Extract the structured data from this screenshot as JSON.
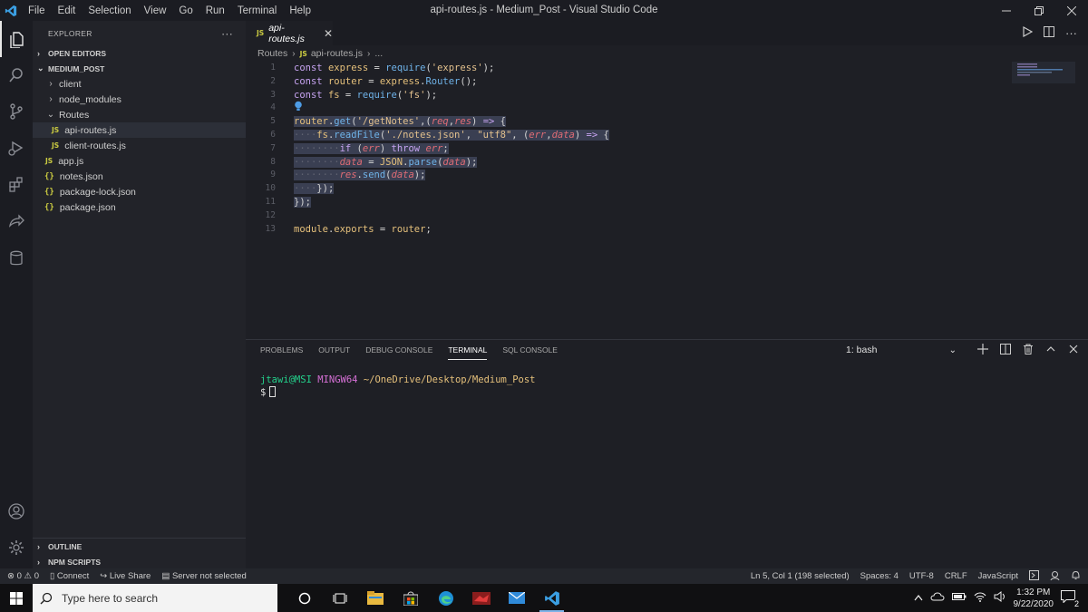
{
  "window": {
    "title": "api-routes.js - Medium_Post - Visual Studio Code",
    "menu": [
      "File",
      "Edit",
      "Selection",
      "View",
      "Go",
      "Run",
      "Terminal",
      "Help"
    ]
  },
  "sidebar": {
    "header": "EXPLORER",
    "more": "···",
    "open_editors": "OPEN EDITORS",
    "project": "MEDIUM_POST",
    "tree": [
      {
        "label": "client",
        "type": "folder"
      },
      {
        "label": "node_modules",
        "type": "folder"
      },
      {
        "label": "Routes",
        "type": "folder-open"
      },
      {
        "label": "api-routes.js",
        "type": "js"
      },
      {
        "label": "client-routes.js",
        "type": "js"
      },
      {
        "label": "app.js",
        "type": "js"
      },
      {
        "label": "notes.json",
        "type": "json"
      },
      {
        "label": "package-lock.json",
        "type": "json"
      },
      {
        "label": "package.json",
        "type": "json"
      }
    ],
    "outline": "OUTLINE",
    "npm_scripts": "NPM SCRIPTS"
  },
  "editor": {
    "tab_badge": "JS",
    "tab_label": "api-routes.js",
    "breadcrumb": {
      "folder": "Routes",
      "file": "api-routes.js",
      "more": "..."
    },
    "line_numbers": [
      "1",
      "2",
      "3",
      "4",
      "5",
      "6",
      "7",
      "8",
      "9",
      "10",
      "11",
      "12",
      "13"
    ]
  },
  "panel": {
    "tabs": [
      "PROBLEMS",
      "OUTPUT",
      "DEBUG CONSOLE",
      "TERMINAL",
      "SQL CONSOLE"
    ],
    "active_tab": "TERMINAL",
    "terminal_select": "1: bash",
    "terminal": {
      "user": "jtawi@MSI",
      "host": "MINGW64",
      "path": "~/OneDrive/Desktop/Medium_Post",
      "prompt": "$"
    }
  },
  "status": {
    "errors": "0",
    "warnings": "0",
    "connect": "Connect",
    "live_share": "Live Share",
    "server": "Server not selected",
    "position": "Ln 5, Col 1 (198 selected)",
    "spaces": "Spaces: 4",
    "encoding": "UTF-8",
    "eol": "CRLF",
    "language": "JavaScript"
  },
  "taskbar": {
    "search_placeholder": "Type here to search",
    "time": "1:32 PM",
    "date": "9/22/2020",
    "notifications": "2"
  },
  "colors": {
    "accent": "#0078d4",
    "keyword": "#c6a3f0",
    "function": "#6fb3e9",
    "string": "#e2c08d",
    "param": "#e06c75",
    "selection": "#3a3f52"
  }
}
